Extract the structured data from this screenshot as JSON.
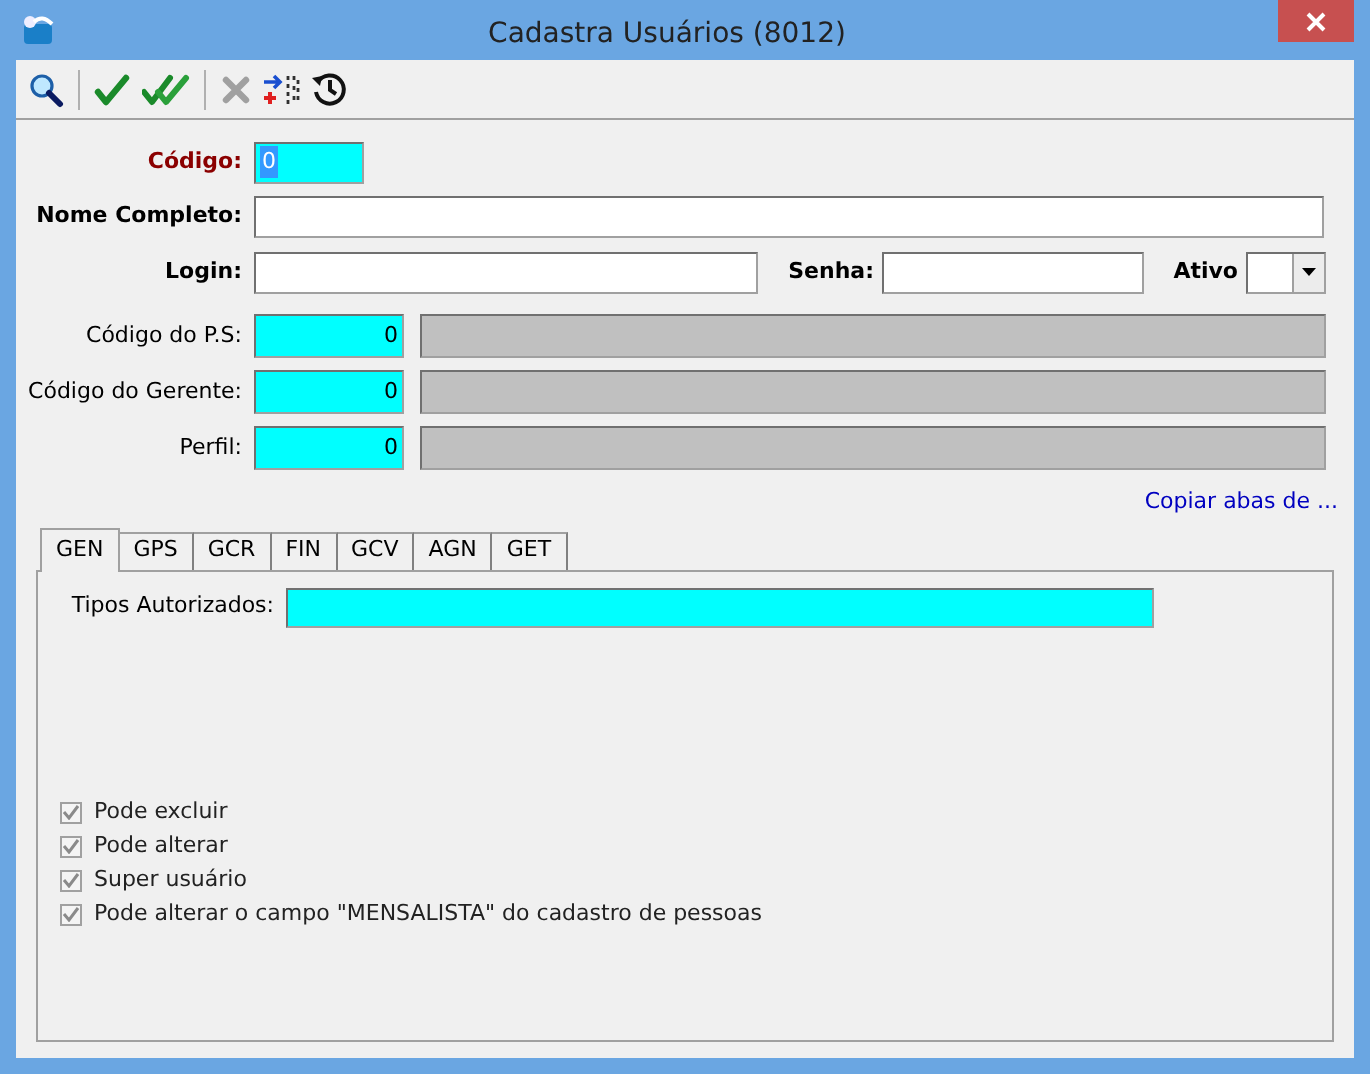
{
  "window": {
    "title": "Cadastra Usuários (8012)"
  },
  "toolbar": [
    {
      "kind": "search",
      "disabled": false
    },
    {
      "kind": "confirm",
      "disabled": false
    },
    {
      "kind": "confirm_all",
      "disabled": false
    },
    {
      "kind": "cancel",
      "disabled": true
    },
    {
      "kind": "transfer",
      "disabled": false
    },
    {
      "kind": "history",
      "disabled": false
    }
  ],
  "codigo": {
    "label": "Código:",
    "value": "0",
    "highlighted": true
  },
  "nome_completo": {
    "label": "Nome Completo:"
  },
  "login": {
    "label": "Login:"
  },
  "senha": {
    "label": "Senha:"
  },
  "ativo": {
    "label": "Ativo"
  },
  "lookups": [
    {
      "label": "Código do P.S:",
      "value": "0"
    },
    {
      "label": "Código do Gerente:",
      "value": "0"
    },
    {
      "label": "Perfil:",
      "value": "0"
    }
  ],
  "copy_link": "Copiar abas de ...",
  "tabs": [
    {
      "label": "GEN",
      "selected": true
    },
    {
      "label": "GPS",
      "selected": false
    },
    {
      "label": "GCR",
      "selected": false
    },
    {
      "label": "FIN",
      "selected": false
    },
    {
      "label": "GCV",
      "selected": false
    },
    {
      "label": "AGN",
      "selected": false
    },
    {
      "label": "GET",
      "selected": false
    }
  ],
  "tipos_autorizados": {
    "label": "Tipos Autorizados:"
  },
  "checkboxes": [
    {
      "label": "Pode excluir",
      "checked": true,
      "disabled": true
    },
    {
      "label": "Pode alterar",
      "checked": true,
      "disabled": true
    },
    {
      "label": "Super usuário",
      "checked": true,
      "disabled": true
    },
    {
      "label": "Pode alterar o campo \"MENSALISTA\" do cadastro de pessoas",
      "checked": true,
      "disabled": true
    }
  ]
}
